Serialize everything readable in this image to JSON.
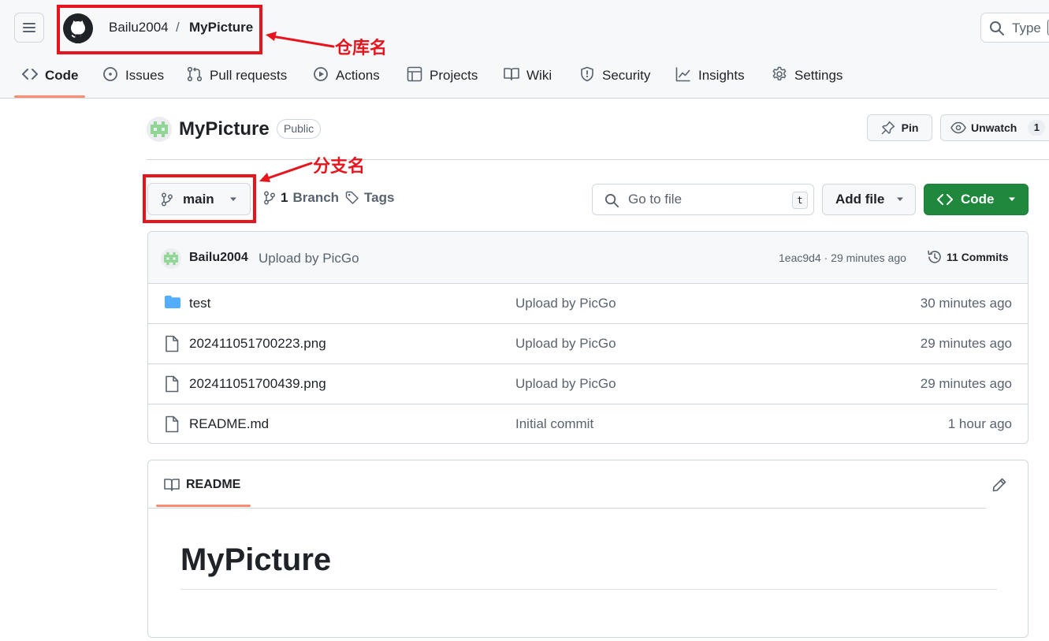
{
  "header": {
    "owner": "Bailu2004",
    "separator": "/",
    "repo": "MyPicture",
    "search_placeholder": "Type"
  },
  "tabs": [
    {
      "label": "Code",
      "icon": "code-icon"
    },
    {
      "label": "Issues",
      "icon": "issue-icon"
    },
    {
      "label": "Pull requests",
      "icon": "pull-request-icon"
    },
    {
      "label": "Actions",
      "icon": "play-icon"
    },
    {
      "label": "Projects",
      "icon": "table-icon"
    },
    {
      "label": "Wiki",
      "icon": "book-icon"
    },
    {
      "label": "Security",
      "icon": "shield-icon"
    },
    {
      "label": "Insights",
      "icon": "graph-icon"
    },
    {
      "label": "Settings",
      "icon": "gear-icon"
    }
  ],
  "repo_header": {
    "title": "MyPicture",
    "visibility": "Public",
    "pin_label": "Pin",
    "unwatch_label": "Unwatch",
    "unwatch_count": "1"
  },
  "branch_bar": {
    "branch": "main",
    "branch_count": "1",
    "branch_label": "Branch",
    "tags_label": "Tags",
    "goto_placeholder": "Go to file",
    "goto_shortcut": "t",
    "add_file_label": "Add file",
    "code_label": "Code"
  },
  "latest_commit": {
    "author": "Bailu2004",
    "message": "Upload by PicGo",
    "hash_time": "1eac9d4 · 29 minutes ago",
    "commits_label": "11 Commits"
  },
  "files": [
    {
      "name": "test",
      "type": "folder",
      "message": "Upload by PicGo",
      "time": "30 minutes ago"
    },
    {
      "name": "202411051700223.png",
      "type": "file",
      "message": "Upload by PicGo",
      "time": "29 minutes ago"
    },
    {
      "name": "202411051700439.png",
      "type": "file",
      "message": "Upload by PicGo",
      "time": "29 minutes ago"
    },
    {
      "name": "README.md",
      "type": "file",
      "message": "Initial commit",
      "time": "1 hour ago"
    }
  ],
  "readme": {
    "tab_label": "README",
    "heading": "MyPicture"
  },
  "annotations": {
    "repo_name": "仓库名",
    "branch_name": "分支名",
    "color": "#e8141d"
  },
  "colors": {
    "accent_tab": "#fd8c73",
    "primary_button": "#1f883d",
    "folder": "#54aeff"
  }
}
